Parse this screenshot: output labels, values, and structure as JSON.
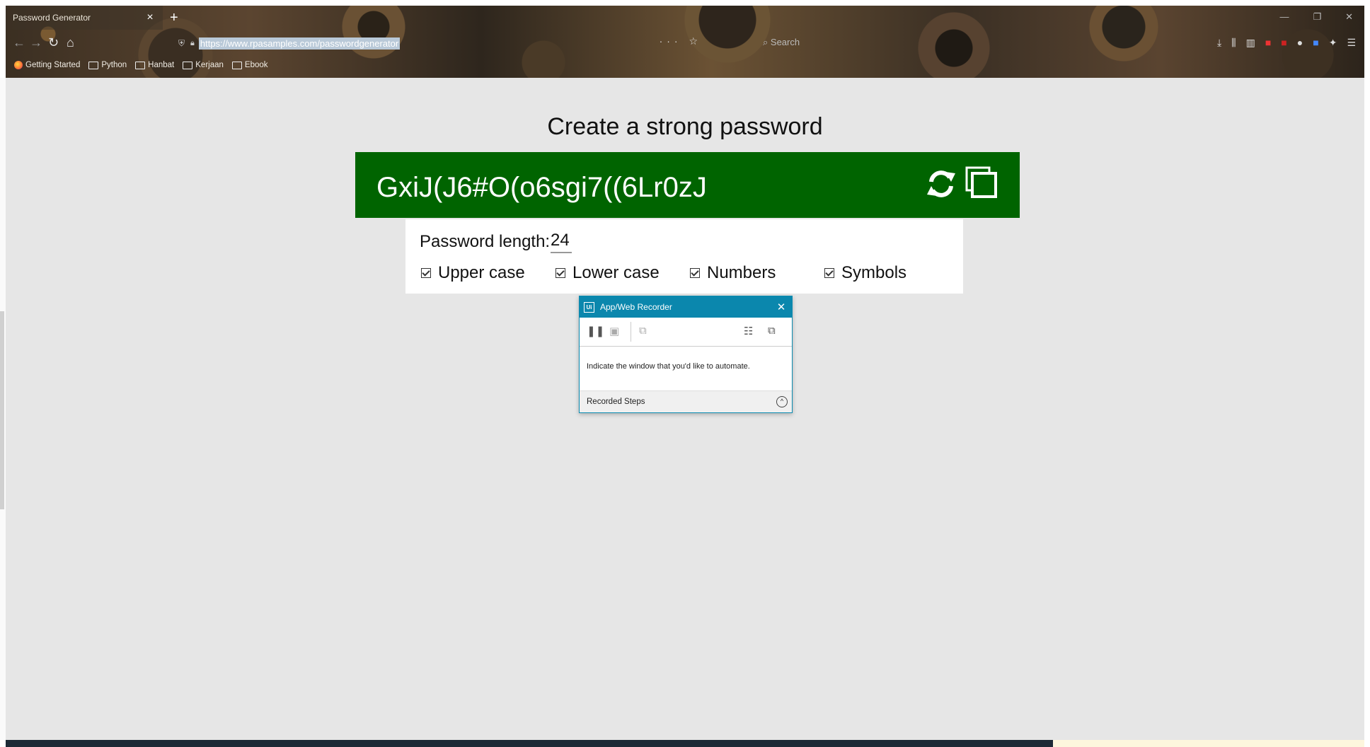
{
  "browser": {
    "tab_title": "Password Generator",
    "tab_close": "×",
    "new_tab": "+",
    "url": "https://www.rpasamples.com/passwordgenerator",
    "search_placeholder": "Search",
    "bookmarks": [
      "Getting Started",
      "Python",
      "Hanbat",
      "Kerjaan",
      "Ebook"
    ]
  },
  "page": {
    "title": "Create a strong password",
    "password": "GxiJ(J6#O(o6sgi7((6Lr0zJ",
    "length_label": "Password length:",
    "length_value": "24",
    "options": [
      "Upper case",
      "Lower case",
      "Numbers",
      "Symbols"
    ]
  },
  "recorder": {
    "title": "App/Web Recorder",
    "logo": "Ui",
    "message": "Indicate the window that you'd like to automate.",
    "steps_label": "Recorded Steps"
  },
  "colors": {
    "password_panel": "#006400",
    "recorder_header": "#0b87ad",
    "page_background": "#e6e6e6"
  }
}
